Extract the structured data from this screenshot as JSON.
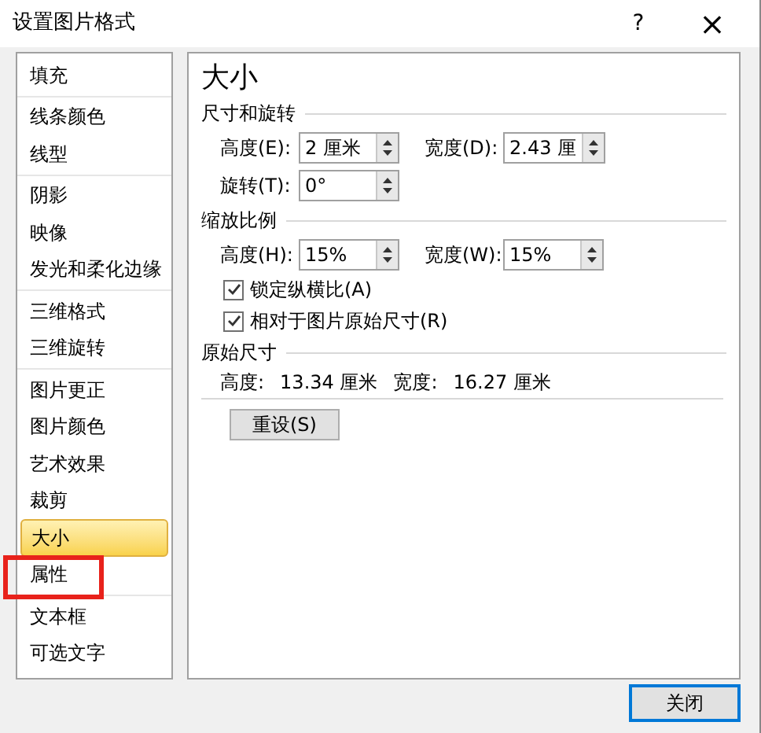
{
  "window": {
    "title": "设置图片格式",
    "help": "?",
    "close": "×"
  },
  "sidebar": {
    "groups": [
      {
        "items": [
          {
            "label": "填充",
            "selected": false,
            "marked": false
          }
        ]
      },
      {
        "items": [
          {
            "label": "线条颜色",
            "selected": false,
            "marked": false
          },
          {
            "label": "线型",
            "selected": false,
            "marked": false
          }
        ]
      },
      {
        "items": [
          {
            "label": "阴影",
            "selected": false,
            "marked": false
          },
          {
            "label": "映像",
            "selected": false,
            "marked": false
          },
          {
            "label": "发光和柔化边缘",
            "selected": false,
            "marked": false
          }
        ]
      },
      {
        "items": [
          {
            "label": "三维格式",
            "selected": false,
            "marked": false
          },
          {
            "label": "三维旋转",
            "selected": false,
            "marked": false
          }
        ]
      },
      {
        "items": [
          {
            "label": "图片更正",
            "selected": false,
            "marked": false
          },
          {
            "label": "图片颜色",
            "selected": false,
            "marked": false
          },
          {
            "label": "艺术效果",
            "selected": false,
            "marked": false
          },
          {
            "label": "裁剪",
            "selected": false,
            "marked": false
          },
          {
            "label": "大小",
            "selected": true,
            "marked": false
          },
          {
            "label": "属性",
            "selected": false,
            "marked": true
          }
        ]
      },
      {
        "items": [
          {
            "label": "文本框",
            "selected": false,
            "marked": false
          },
          {
            "label": "可选文字",
            "selected": false,
            "marked": false
          }
        ]
      }
    ]
  },
  "panel": {
    "title": "大小",
    "sections": [
      {
        "heading": "尺寸和旋转",
        "rows": [
          {
            "kind": "spinners",
            "fields": [
              {
                "label": "高度(E):",
                "value": "2 厘米"
              },
              {
                "label": "宽度(D):",
                "value": "2.43 厘"
              }
            ]
          },
          {
            "kind": "spinners",
            "fields": [
              {
                "label": "旋转(T):",
                "value": "0°"
              }
            ]
          }
        ]
      },
      {
        "heading": "缩放比例",
        "rows": [
          {
            "kind": "spinners",
            "fields": [
              {
                "label": "高度(H):",
                "value": "15%"
              },
              {
                "label": "宽度(W):",
                "value": "15%"
              }
            ]
          },
          {
            "kind": "checkbox",
            "label": "锁定纵横比(A)",
            "checked": true
          },
          {
            "kind": "checkbox",
            "label": "相对于图片原始尺寸(R)",
            "checked": true
          }
        ]
      },
      {
        "heading": "原始尺寸",
        "rows": [
          {
            "kind": "info",
            "texts": [
              "高度:",
              "13.34 厘米",
              "宽度:",
              "16.27 厘米"
            ]
          }
        ]
      }
    ],
    "reset_button": "重设(S)"
  },
  "close_button": "关闭"
}
